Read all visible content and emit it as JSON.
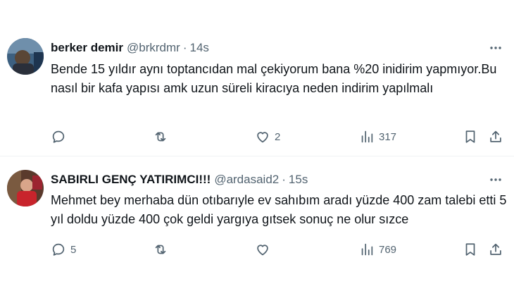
{
  "tweets": [
    {
      "name": "berker demir",
      "handle": "@brkrdmr",
      "sep": "·",
      "time": "14s",
      "text": "Bende 15 yıldır aynı toptancıdan mal çekiyorum bana %20 inidirim yapmıyor.Bu nasıl bir kafa yapısı amk uzun süreli kiracıya neden indirim yapılmalı",
      "replies": "",
      "retweets": "",
      "likes": "2",
      "views": "317",
      "avatar_colors": [
        "#2b4a6e",
        "#7a6a5a"
      ]
    },
    {
      "name": "SABIRLI GENÇ YATIRIMCI!!!",
      "handle": "@ardasaid2",
      "sep": "·",
      "time": "15s",
      "text": "Mehmet bey merhaba dün otıbarıyle ev sahıbım aradı yüzde 400 zam talebi etti 5 yıl doldu yüzde 400 çok geldi yargıya gıtsek sonuç ne olur sızce",
      "replies": "5",
      "retweets": "",
      "likes": "",
      "views": "769",
      "avatar_colors": [
        "#b3262e",
        "#3a2a24"
      ]
    }
  ],
  "icons": {
    "reply": "reply-icon",
    "retweet": "retweet-icon",
    "like": "heart-icon",
    "views": "views-icon",
    "bookmark": "bookmark-icon",
    "share": "share-icon",
    "more": "more-icon"
  },
  "colors": {
    "text": "#0f1419",
    "secondary": "#536471",
    "divider": "#eff3f4"
  }
}
